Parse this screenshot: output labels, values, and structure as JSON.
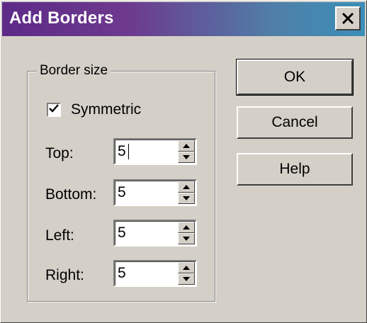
{
  "window": {
    "title": "Add Borders",
    "close_icon": "close-icon"
  },
  "border_size": {
    "group_label": "Border size",
    "symmetric": {
      "label": "Symmetric",
      "checked": true
    },
    "fields": [
      {
        "label": "Top:",
        "value": "5"
      },
      {
        "label": "Bottom:",
        "value": "5"
      },
      {
        "label": "Left:",
        "value": "5"
      },
      {
        "label": "Right:",
        "value": "5"
      }
    ]
  },
  "buttons": {
    "ok_label": "OK",
    "cancel_label": "Cancel",
    "help_label": "Help"
  },
  "colors": {
    "title_gradient_start": "#5e2a88",
    "title_gradient_end": "#3b8fb8",
    "face": "#d4d0c8"
  }
}
